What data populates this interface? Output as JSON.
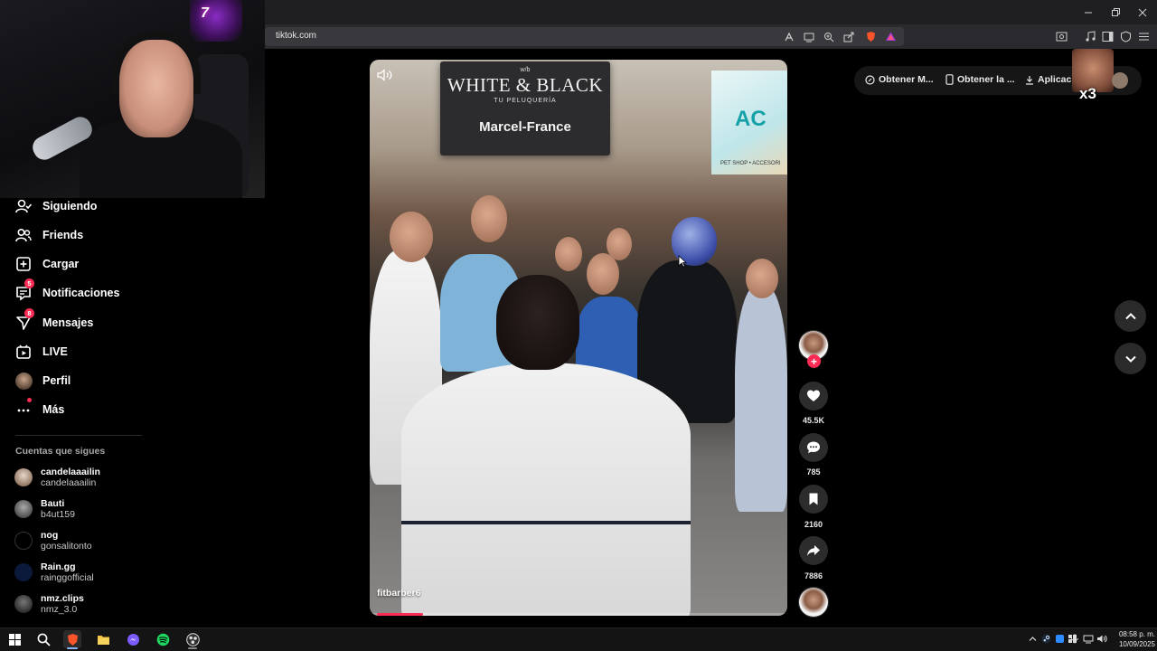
{
  "browser": {
    "url": "tiktok.com"
  },
  "webcam": {
    "neon_text": "7"
  },
  "sidebar": {
    "items": [
      {
        "label": "Siguiendo",
        "icon": "following-icon"
      },
      {
        "label": "Friends",
        "icon": "friends-icon"
      },
      {
        "label": "Cargar",
        "icon": "upload-icon"
      },
      {
        "label": "Notificaciones",
        "icon": "inbox-icon",
        "badge": "5"
      },
      {
        "label": "Mensajes",
        "icon": "messages-icon",
        "badge": "8"
      },
      {
        "label": "LIVE",
        "icon": "live-icon"
      },
      {
        "label": "Perfil",
        "icon": "profile-avatar"
      },
      {
        "label": "Más",
        "icon": "more-icon"
      }
    ],
    "following_title": "Cuentas que sigues",
    "accounts": [
      {
        "name": "candelaaailin",
        "handle": "candelaaailin"
      },
      {
        "name": "Bauti",
        "handle": "b4ut159"
      },
      {
        "name": "nog",
        "handle": "gonsalitonto"
      },
      {
        "name": "Rain.gg",
        "handle": "rainggofficial"
      },
      {
        "name": "nmz.clips",
        "handle": "nmz_3.0"
      }
    ]
  },
  "video": {
    "sign_small": "w/b",
    "sign_title": "WHITE & BLACK",
    "sign_sub": "TU PELUQUERÍA",
    "sign_brand": "Marcel-France",
    "shop_letters": "AC",
    "shop_foot": "PET SHOP • ACCESORI",
    "author": "fitbarber6",
    "progress": 0.11
  },
  "actions": {
    "likes": "45.5K",
    "comments": "785",
    "saves": "2160",
    "shares": "7886",
    "follow": "+"
  },
  "topbar": {
    "item1": "Obtener M...",
    "item2": "Obtener la ...",
    "item3": "Aplicaci",
    "emote": "x3"
  },
  "taskbar": {
    "time": "08:58 p. m.",
    "date": "10/09/2025"
  },
  "colors": {
    "accent": "#fe2c55",
    "background": "#000000"
  }
}
